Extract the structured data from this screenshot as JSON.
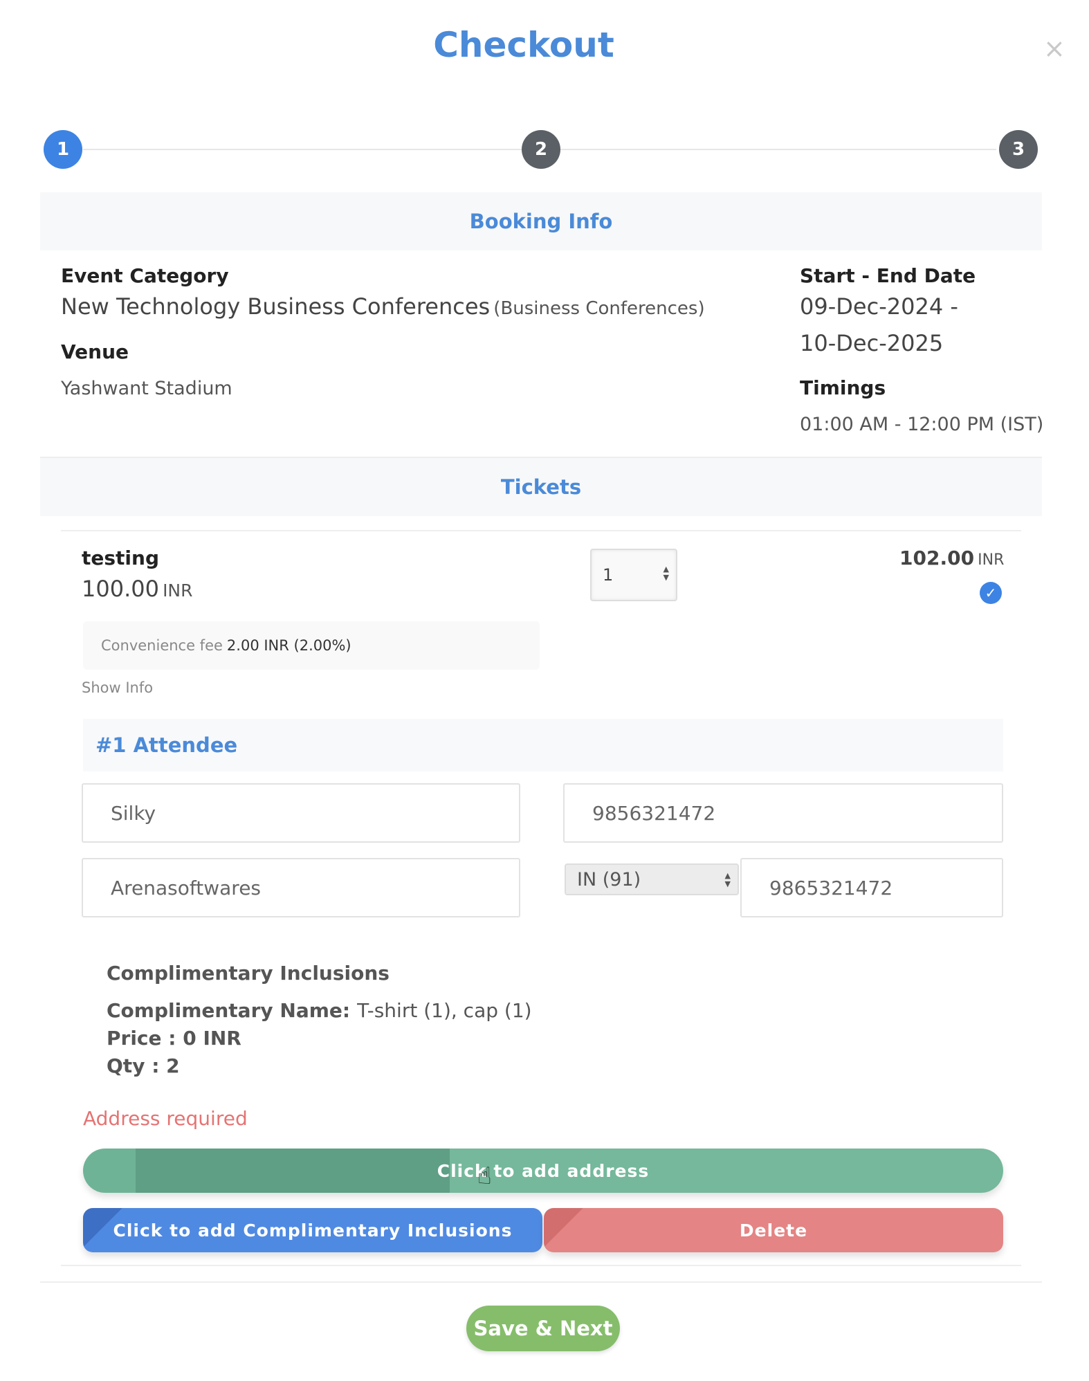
{
  "modal": {
    "title": "Checkout",
    "close_icon": "×"
  },
  "steps": [
    {
      "label": "1",
      "state": "active"
    },
    {
      "label": "2",
      "state": "idle"
    },
    {
      "label": "3",
      "state": "idle"
    }
  ],
  "booking_info": {
    "header": "Booking Info",
    "event_category_label": "Event Category",
    "event_category_value": "New Technology Business Conferences",
    "event_category_sub": "(Business Conferences)",
    "venue_label": "Venue",
    "venue_value": "Yashwant Stadium",
    "date_label": "Start - End Date",
    "date_start": "09-Dec-2024 -",
    "date_end": "10-Dec-2025",
    "timings_label": "Timings",
    "timings_value": "01:00 AM - 12:00 PM (IST)"
  },
  "tickets": {
    "header": "Tickets",
    "ticket_name": "testing",
    "ticket_price": "100.00",
    "ticket_currency": "INR",
    "quantity": "1",
    "total_price": "102.00",
    "total_currency": "INR",
    "fee_label": "Convenience fee",
    "fee_value": "2.00 INR (2.00%)",
    "show_info": "Show Info"
  },
  "attendee": {
    "header": "#1 Attendee",
    "name": "Silky",
    "phone": "9856321472",
    "company": "Arenasoftwares",
    "country_code": "IN (91)",
    "mobile": "9865321472"
  },
  "complimentary": {
    "title": "Complimentary Inclusions",
    "name_label": "Complimentary Name:",
    "name_value": "T-shirt (1), cap (1)",
    "price_line": "Price : 0 INR",
    "qty_line": "Qty : 2"
  },
  "actions": {
    "address_error": "Address required",
    "add_address": "Click to add address",
    "add_complimentary": "Click to add Complimentary Inclusions",
    "delete": "Delete",
    "save_next": "Save & Next"
  },
  "colors": {
    "accent": "#4a8ad8",
    "step_active": "#3d83e3",
    "step_idle": "#5b6066",
    "green_button": "#6fb397",
    "blue_button": "#4f8ae2",
    "red_button": "#e48484",
    "save_button": "#86bd6b",
    "error_text": "#e57373"
  }
}
